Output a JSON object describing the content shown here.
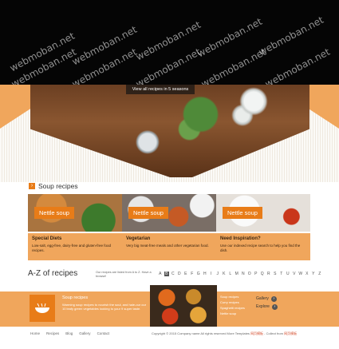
{
  "watermark": "webmoban.net",
  "hero": {
    "view_all_label": "View all recipes in 5 seasons"
  },
  "soup_section": {
    "title": "Soup recipes"
  },
  "tiles": [
    {
      "label": "Nettle soup"
    },
    {
      "label": "Nettle soup"
    },
    {
      "label": "Nettle soup"
    }
  ],
  "info_boxes": [
    {
      "heading": "Special Diets",
      "text": "Low-salt, egg-free, dairy-free and gluten-free food recipes."
    },
    {
      "heading": "Vegetarian",
      "text": "Very big meat-free meals and other vegetarian food."
    },
    {
      "heading": "Need Inspiration?",
      "text": "Use our indexed recipe search to help you find the dish."
    }
  ],
  "az": {
    "title": "A-Z of recipes",
    "note": "Our recipes are listed from A to Z. Have a browse!",
    "letters": [
      "A",
      "B",
      "C",
      "D",
      "E",
      "F",
      "G",
      "H",
      "I",
      "J",
      "K",
      "L",
      "M",
      "N",
      "O",
      "P",
      "Q",
      "R",
      "S",
      "T",
      "U",
      "V",
      "W",
      "X",
      "Y",
      "Z"
    ],
    "active": "B"
  },
  "band": {
    "title": "Soup recipes",
    "text": "Warming soup recipes to nourish the soul, and hale-our our 10 leafy green vegetables looking to your 9 super taste.",
    "list": [
      "Soup recipes",
      "Curry recipes",
      "Spaghetti recipes",
      "Nettle soup"
    ],
    "gallery_label": "Gallery",
    "explore_label": "Explore"
  },
  "footer": {
    "nav": [
      "Home",
      "Recipes",
      "Blog",
      "Gallery",
      "Contact"
    ],
    "copyright": "Copyright © 2015 Company name All rights reserved More Templates",
    "link1": "网页模板",
    "mid": " - Collect from",
    "link2": "网页模板"
  }
}
